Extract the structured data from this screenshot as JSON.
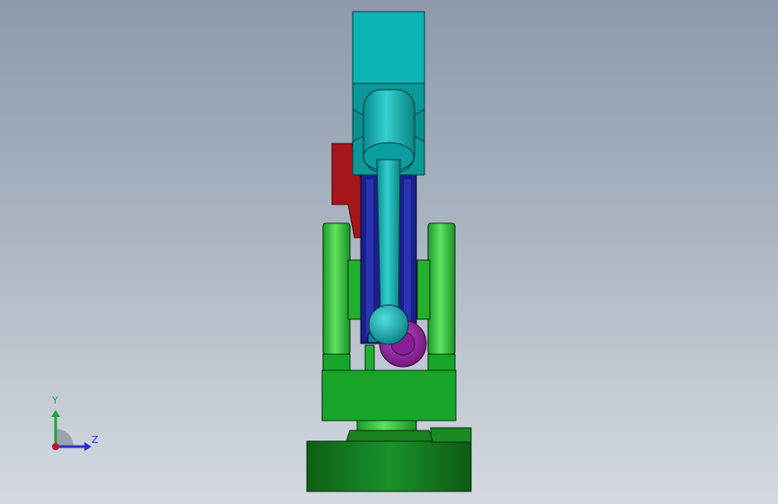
{
  "viewport": {
    "background_top": "#8d9aab",
    "background_bottom": "#d5dae0",
    "model_parts": [
      "base",
      "turntable",
      "shoulder-block",
      "left-bracket",
      "right-bracket",
      "upper-arm-frame",
      "counterweight",
      "wrist-housing",
      "wrist-joint",
      "tool-shaft",
      "tool-ball",
      "end-effector-gear"
    ]
  },
  "triad": {
    "y_label": "Y",
    "z_label": "Z",
    "y_color": "#1ea33a",
    "z_color": "#2633c9",
    "x_color": "#c8102e"
  }
}
